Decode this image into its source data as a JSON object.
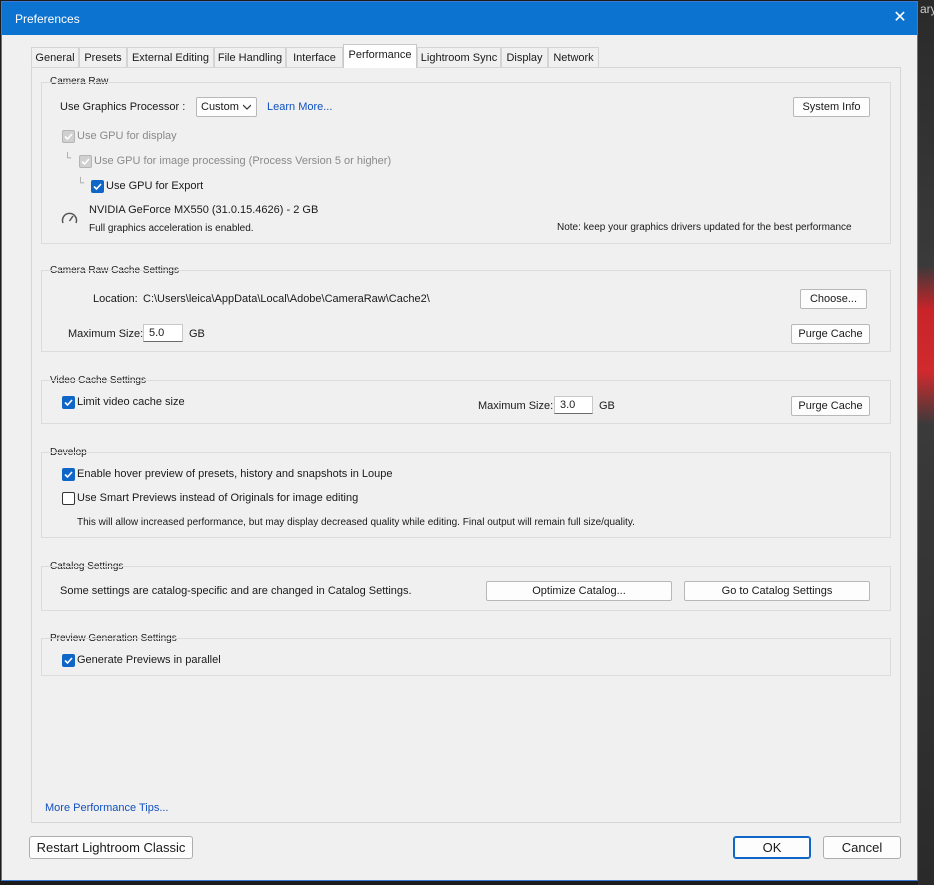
{
  "window": {
    "title": "Preferences",
    "close_symbol": "✕"
  },
  "background": {
    "right_edge_text": "ary"
  },
  "tabs": [
    {
      "label": "General"
    },
    {
      "label": "Presets"
    },
    {
      "label": "External Editing"
    },
    {
      "label": "File Handling"
    },
    {
      "label": "Interface"
    },
    {
      "label": "Performance",
      "active": true
    },
    {
      "label": "Lightroom Sync"
    },
    {
      "label": "Display"
    },
    {
      "label": "Network"
    }
  ],
  "camera_raw": {
    "title": "Camera Raw",
    "gpu_label": "Use Graphics Processor :",
    "gpu_value": "Custom",
    "learn_more": "Learn More...",
    "system_info": "System Info",
    "use_gpu_display": "Use GPU for display",
    "use_gpu_processing": "Use GPU for image processing (Process Version 5 or higher)",
    "use_gpu_export": "Use GPU for Export",
    "gpu_name": "NVIDIA GeForce MX550 (31.0.15.4626) - 2 GB",
    "accel_status": "Full graphics acceleration is enabled.",
    "driver_note": "Note: keep your graphics drivers updated for the best performance"
  },
  "cache": {
    "title": "Camera Raw Cache Settings",
    "location_label": "Location:",
    "location_value": "C:\\Users\\leica\\AppData\\Local\\Adobe\\CameraRaw\\Cache2\\",
    "choose": "Choose...",
    "max_label": "Maximum Size:",
    "max_value": "5.0",
    "unit": "GB",
    "purge": "Purge Cache"
  },
  "video_cache": {
    "title": "Video Cache Settings",
    "limit_label": "Limit video cache size",
    "max_label": "Maximum Size:",
    "max_value": "3.0",
    "unit": "GB",
    "purge": "Purge Cache"
  },
  "develop": {
    "title": "Develop",
    "hover_preview": "Enable hover preview of presets, history and snapshots in Loupe",
    "smart_previews": "Use Smart Previews instead of Originals for image editing",
    "smart_note": "This will allow increased performance, but may display decreased quality while editing. Final output will remain full size/quality."
  },
  "catalog": {
    "title": "Catalog Settings",
    "note": "Some settings are catalog-specific and are changed in Catalog Settings.",
    "optimize": "Optimize Catalog...",
    "goto": "Go to Catalog Settings"
  },
  "preview": {
    "title": "Preview Generation Settings",
    "parallel": "Generate Previews in parallel"
  },
  "more_tips": "More Performance Tips...",
  "footer": {
    "restart": "Restart Lightroom Classic",
    "ok": "OK",
    "cancel": "Cancel"
  },
  "colors": {
    "title_bar": "#0d73d0",
    "checkbox_on": "#0f66c6",
    "link": "#1050c0"
  }
}
